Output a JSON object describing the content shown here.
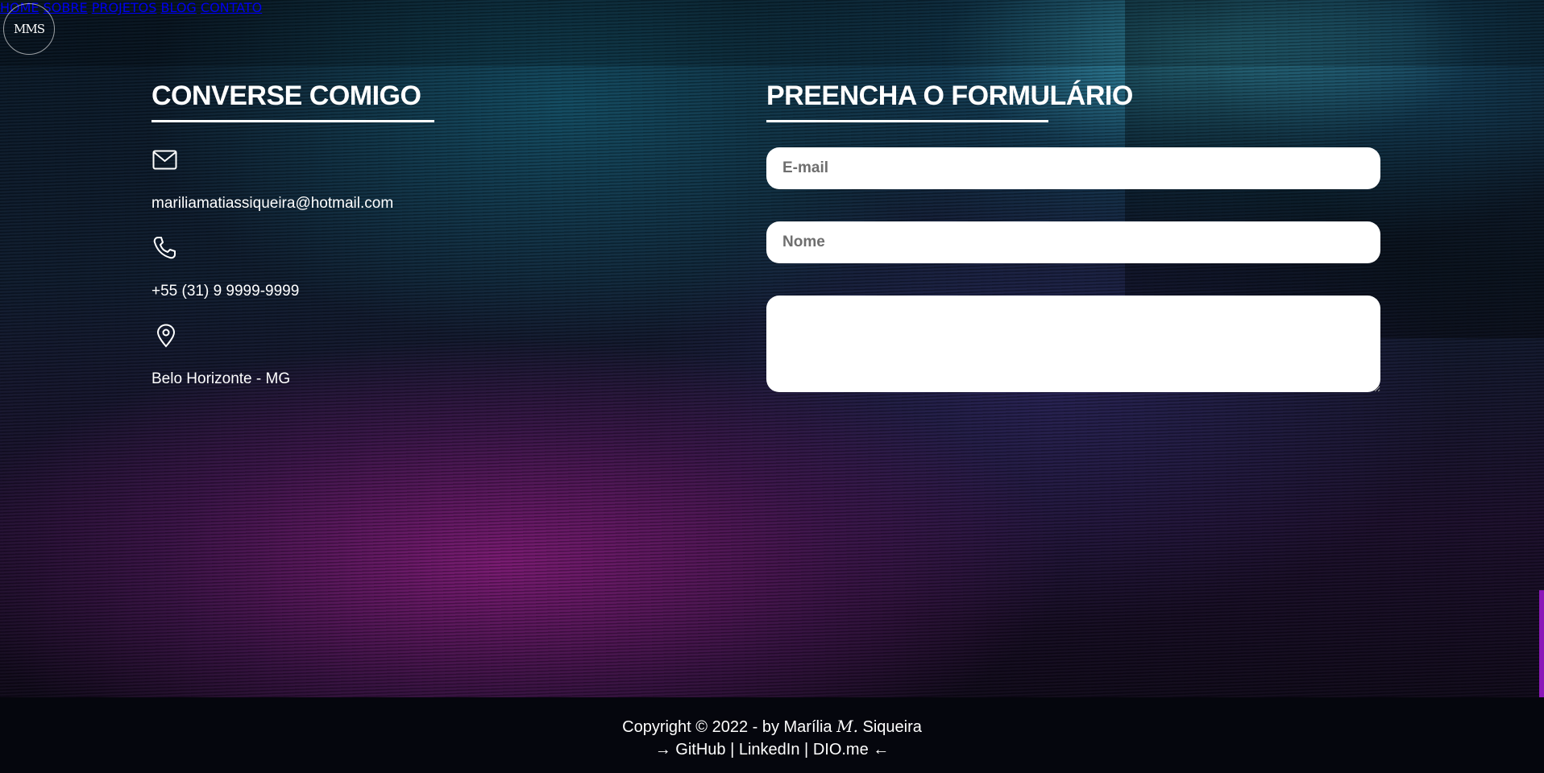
{
  "header": {
    "logo_text": "MMS",
    "nav": [
      "HOME",
      "SOBRE",
      "PROJETOS",
      "BLOG",
      "CONTATO"
    ]
  },
  "contact": {
    "title": "CONVERSE COMIGO",
    "email_icon": "envelope-icon",
    "email": "mariliamatiassiqueira@hotmail.com",
    "phone_icon": "phone-icon",
    "phone": "+55 (31) 9 9999-9999",
    "location_icon": "map-pin-icon",
    "location": "Belo Horizonte - MG"
  },
  "form": {
    "title": "PREENCHA O FORMULÁRIO",
    "email_placeholder": "E-mail",
    "name_placeholder": "Nome",
    "message_placeholder": ""
  },
  "footer": {
    "copyright_prefix": "Copyright © 2022 - by Marília ",
    "signature": "M.",
    "copyright_suffix": " Siqueira",
    "arrow_left": "→",
    "github": "GitHub",
    "sep1": "|",
    "linkedin": "LinkedIn",
    "sep2": "|",
    "dio": "DIO.me",
    "arrow_right": "←"
  },
  "colors": {
    "accent_scroll": "#8b18b8",
    "footer_bg": "#05060d"
  }
}
